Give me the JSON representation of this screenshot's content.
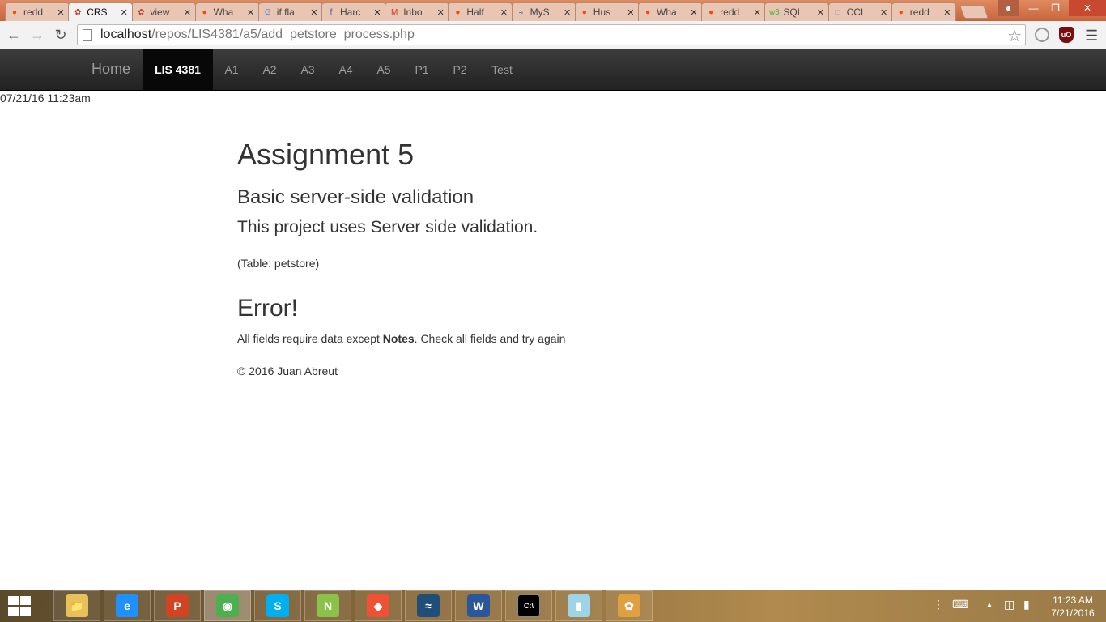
{
  "browser": {
    "tabs": [
      {
        "title": "redd",
        "icon": "reddit-icon"
      },
      {
        "title": "CRS",
        "icon": "crs-icon",
        "active": true
      },
      {
        "title": "view",
        "icon": "crs-icon"
      },
      {
        "title": "Wha",
        "icon": "reddit-icon"
      },
      {
        "title": "if fla",
        "icon": "google-icon"
      },
      {
        "title": "Harc",
        "icon": "facebook-icon"
      },
      {
        "title": "Inbo",
        "icon": "gmail-icon"
      },
      {
        "title": "Half",
        "icon": "reddit-icon"
      },
      {
        "title": "MyS",
        "icon": "mysql-icon"
      },
      {
        "title": "Hus",
        "icon": "reddit-icon"
      },
      {
        "title": "Wha",
        "icon": "reddit-icon"
      },
      {
        "title": "redd",
        "icon": "reddit-icon"
      },
      {
        "title": "SQL",
        "icon": "w3-icon"
      },
      {
        "title": "CCI",
        "icon": "page-icon"
      },
      {
        "title": "redd",
        "icon": "reddit-icon"
      }
    ],
    "url_host": "localhost",
    "url_path": "/repos/LIS4381/a5/add_petstore_process.php"
  },
  "navbar": {
    "brand": "Home",
    "items": [
      "LIS 4381",
      "A1",
      "A2",
      "A3",
      "A4",
      "A5",
      "P1",
      "P2",
      "Test"
    ]
  },
  "datetime": "07/21/16 11:23am",
  "main": {
    "title": "Assignment 5",
    "subtitle": "Basic server-side validation",
    "description": "This project uses Server side validation.",
    "table_note": "(Table: petstore)",
    "error_heading": "Error!",
    "error_prefix": "All fields require data except ",
    "error_bold": "Notes",
    "error_suffix": ". Check all fields and try again",
    "footer": "© 2016 Juan Abreut"
  },
  "taskbar": {
    "apps": [
      "file-explorer-icon",
      "internet-explorer-icon",
      "powerpoint-icon",
      "chrome-icon",
      "skype-icon",
      "notepad-plus-icon",
      "git-icon",
      "mysql-workbench-icon",
      "word-icon",
      "cmd-icon",
      "notes-icon",
      "paint-icon"
    ],
    "time": "11:23 AM",
    "date": "7/21/2016"
  }
}
